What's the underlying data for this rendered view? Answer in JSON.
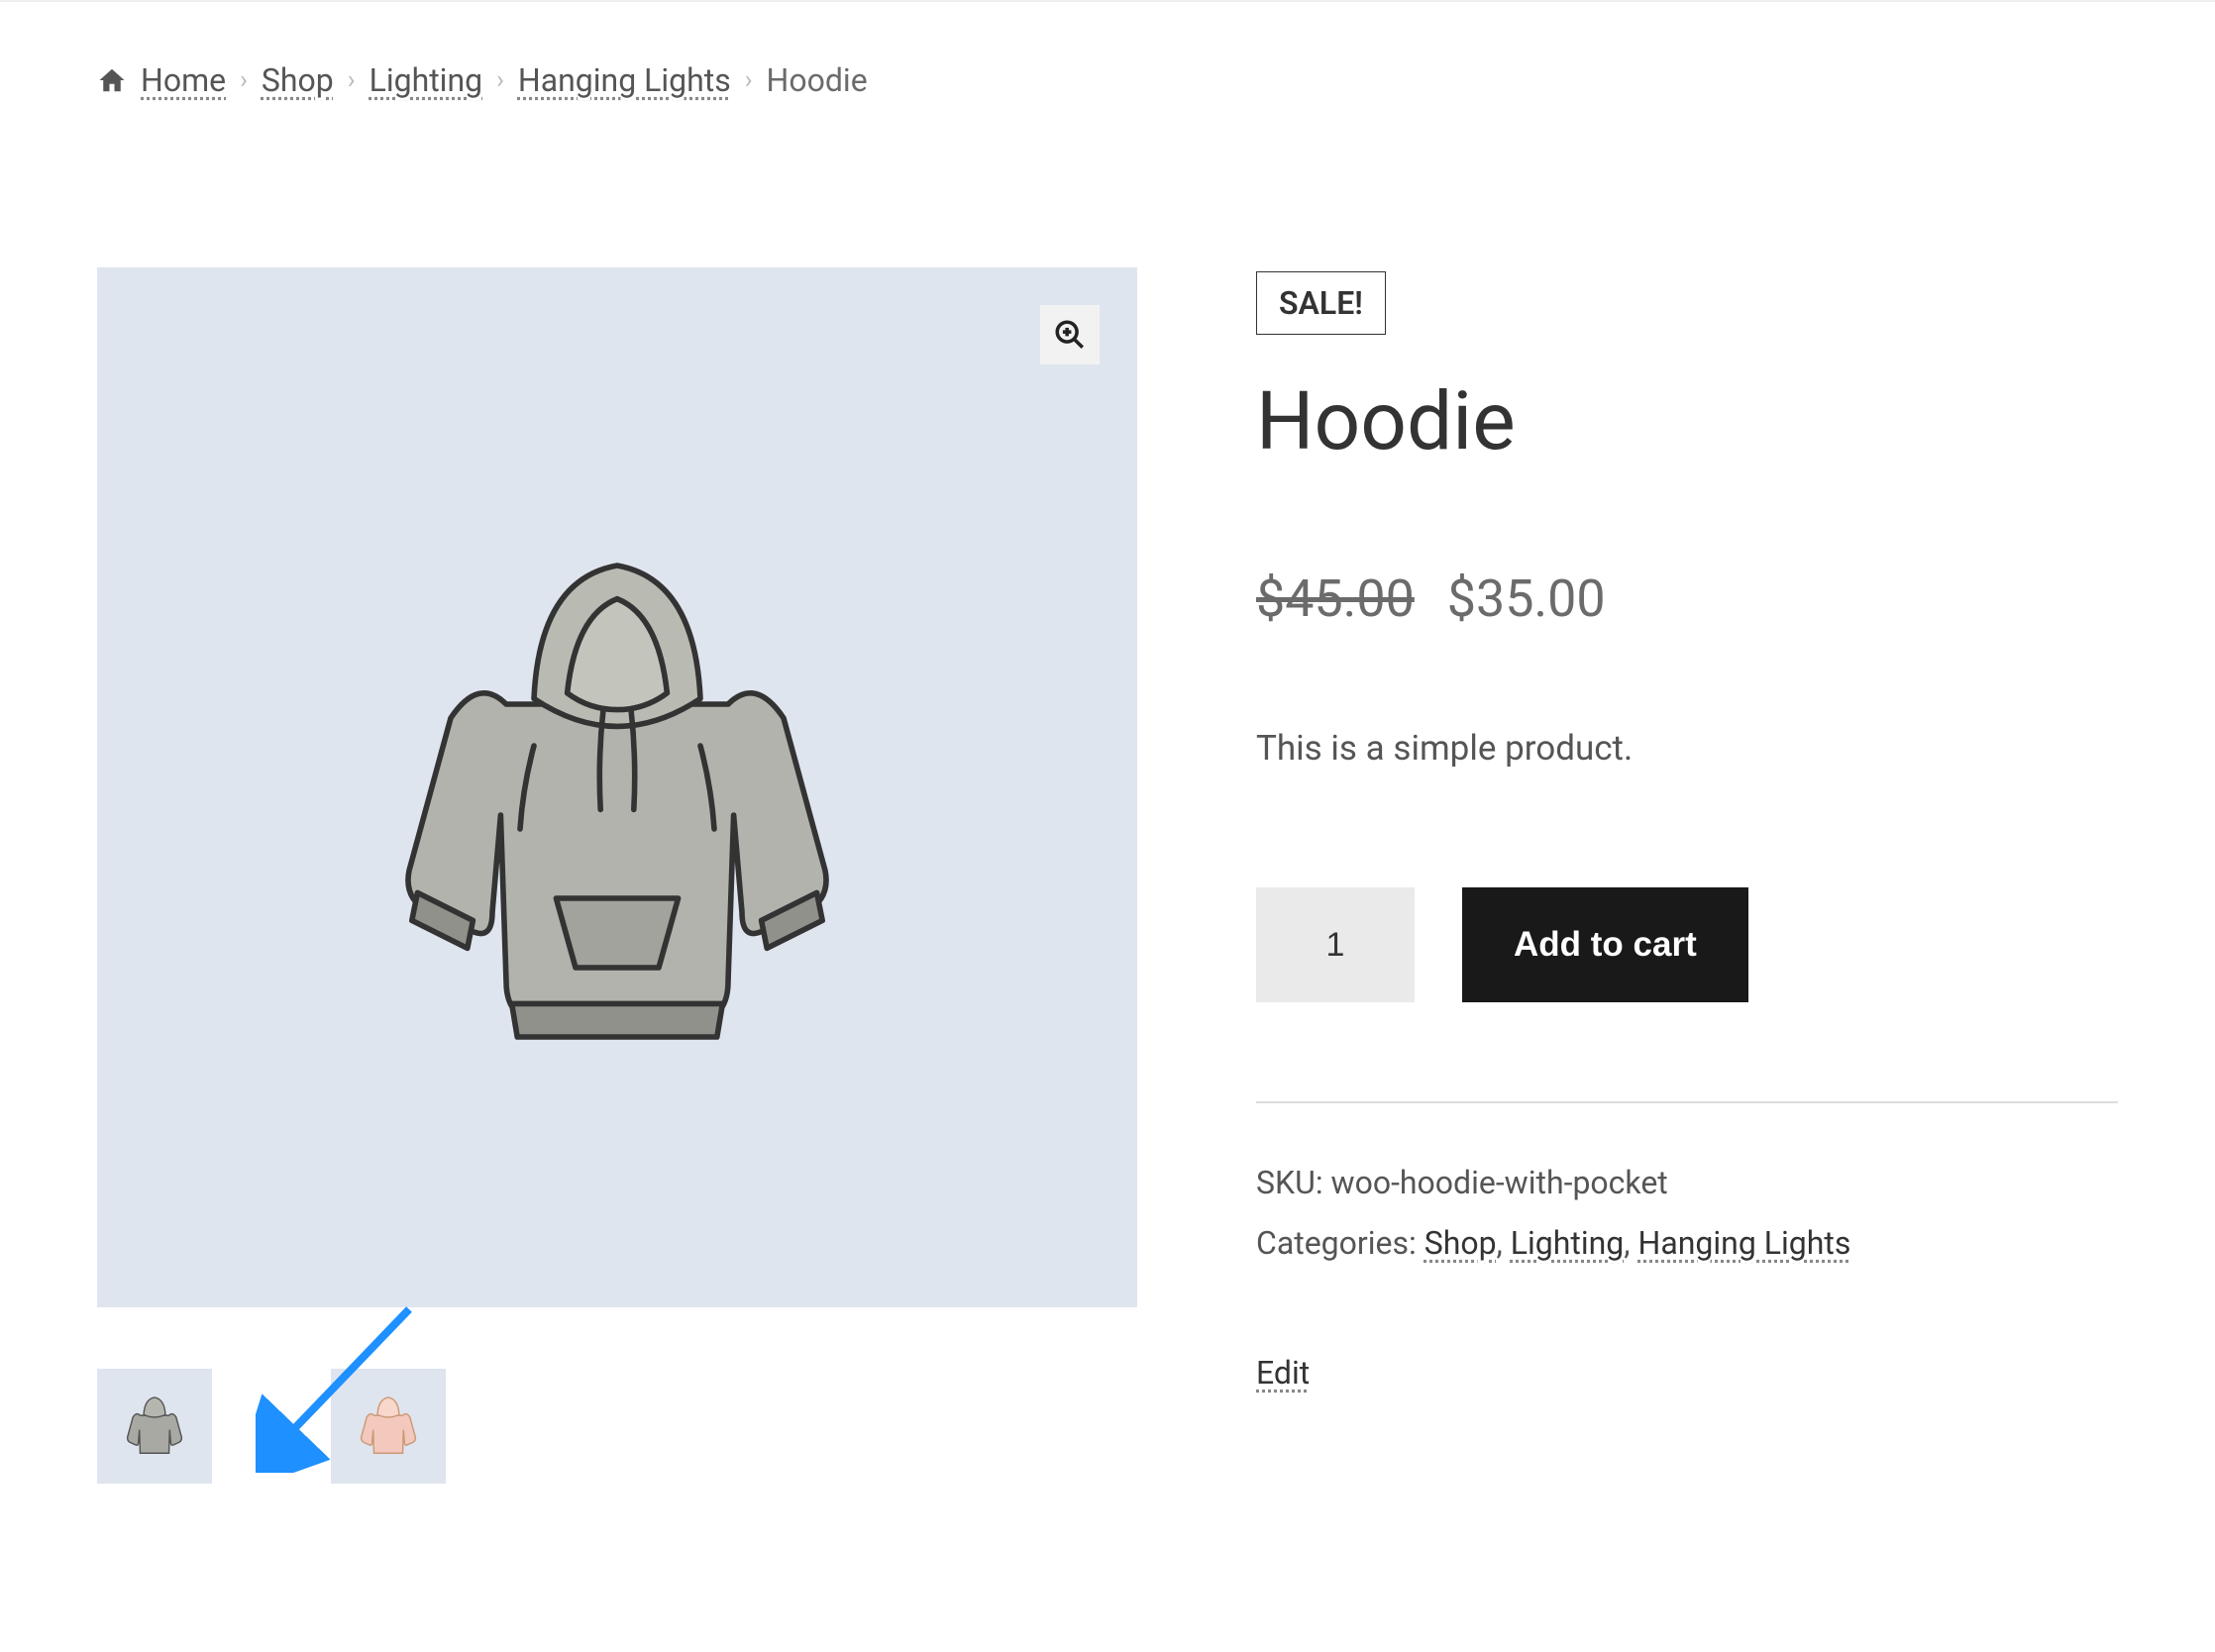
{
  "breadcrumb": {
    "home": "Home",
    "shop": "Shop",
    "lighting": "Lighting",
    "hanging": "Hanging Lights",
    "current": "Hoodie"
  },
  "product": {
    "sale_badge": "SALE!",
    "title": "Hoodie",
    "old_price": "$45.00",
    "price": "$35.00",
    "description": "This is a simple product.",
    "quantity": "1",
    "add_to_cart": "Add to cart",
    "sku_label": "SKU: ",
    "sku_value": "woo-hoodie-with-pocket",
    "categories_label": "Categories: ",
    "cat_shop": "Shop",
    "cat_lighting": "Lighting",
    "cat_hanging": "Hanging Lights",
    "edit": "Edit"
  }
}
